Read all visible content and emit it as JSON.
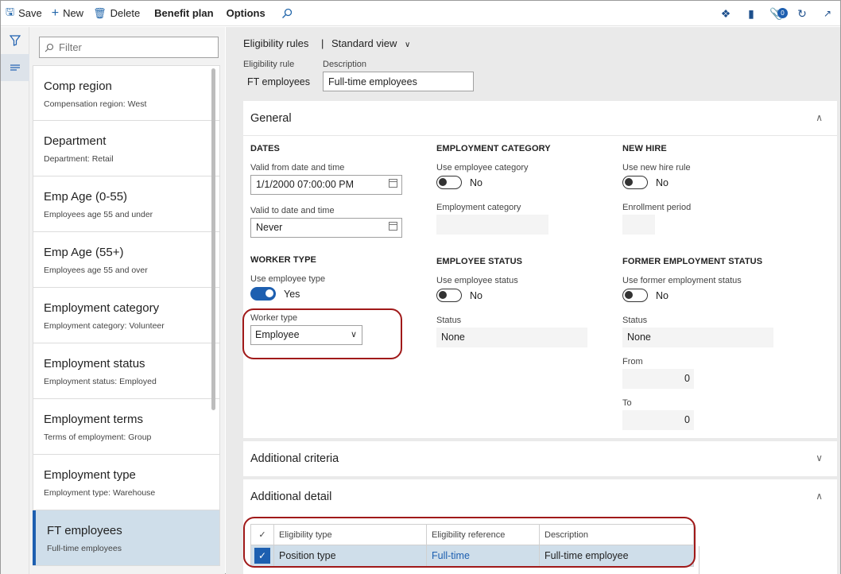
{
  "toolbar": {
    "save": "Save",
    "new": "New",
    "delete": "Delete",
    "benefit_plan": "Benefit plan",
    "options": "Options",
    "search_icon": "search-icon",
    "notification_count": "0"
  },
  "filter": {
    "placeholder": "Filter"
  },
  "list": [
    {
      "title": "Comp region",
      "subtitle": "Compensation region:  West"
    },
    {
      "title": "Department",
      "subtitle": "Department:  Retail"
    },
    {
      "title": "Emp Age (0-55)",
      "subtitle": "Employees age 55 and under"
    },
    {
      "title": "Emp Age (55+)",
      "subtitle": "Employees age 55 and over"
    },
    {
      "title": "Employment category",
      "subtitle": "Employment category:  Volunteer"
    },
    {
      "title": "Employment status",
      "subtitle": "Employment status: Employed"
    },
    {
      "title": "Employment terms",
      "subtitle": "Terms of employment: Group"
    },
    {
      "title": "Employment type",
      "subtitle": "Employment type: Warehouse"
    },
    {
      "title": "FT employees",
      "subtitle": "Full-time employees"
    }
  ],
  "breadcrumb": {
    "page": "Eligibility rules",
    "separator": "|",
    "view": "Standard view"
  },
  "header": {
    "rule_label": "Eligibility rule",
    "rule_value": "FT employees",
    "desc_label": "Description",
    "desc_value": "Full-time employees"
  },
  "general": {
    "title": "General",
    "dates": {
      "heading": "DATES",
      "from_label": "Valid from date and time",
      "from_value": "1/1/2000 07:00:00 PM",
      "to_label": "Valid to date and time",
      "to_value": "Never"
    },
    "worker_type": {
      "heading": "WORKER TYPE",
      "use_label": "Use employee type",
      "use_value": "Yes",
      "type_label": "Worker type",
      "type_value": "Employee"
    },
    "employment_category": {
      "heading": "EMPLOYMENT CATEGORY",
      "use_label": "Use employee category",
      "use_value": "No",
      "cat_label": "Employment category",
      "cat_value": ""
    },
    "employee_status": {
      "heading": "EMPLOYEE STATUS",
      "use_label": "Use employee status",
      "use_value": "No",
      "status_label": "Status",
      "status_value": "None"
    },
    "new_hire": {
      "heading": "NEW HIRE",
      "use_label": "Use new hire rule",
      "use_value": "No",
      "period_label": "Enrollment period",
      "period_value": ""
    },
    "former_status": {
      "heading": "FORMER EMPLOYMENT STATUS",
      "use_label": "Use former employment status",
      "use_value": "No",
      "status_label": "Status",
      "status_value": "None",
      "from_label": "From",
      "from_value": "0",
      "to_label": "To",
      "to_value": "0"
    }
  },
  "additional_criteria": {
    "title": "Additional criteria"
  },
  "additional_detail": {
    "title": "Additional detail",
    "columns": [
      "Eligibility type",
      "Eligibility reference",
      "Description"
    ],
    "rows": [
      {
        "type": "Position type",
        "reference": "Full-time",
        "description": "Full-time employee"
      }
    ]
  },
  "colors": {
    "accent": "#1d5fb0",
    "highlight": "#a01919",
    "selected_row": "#cfdeea"
  }
}
